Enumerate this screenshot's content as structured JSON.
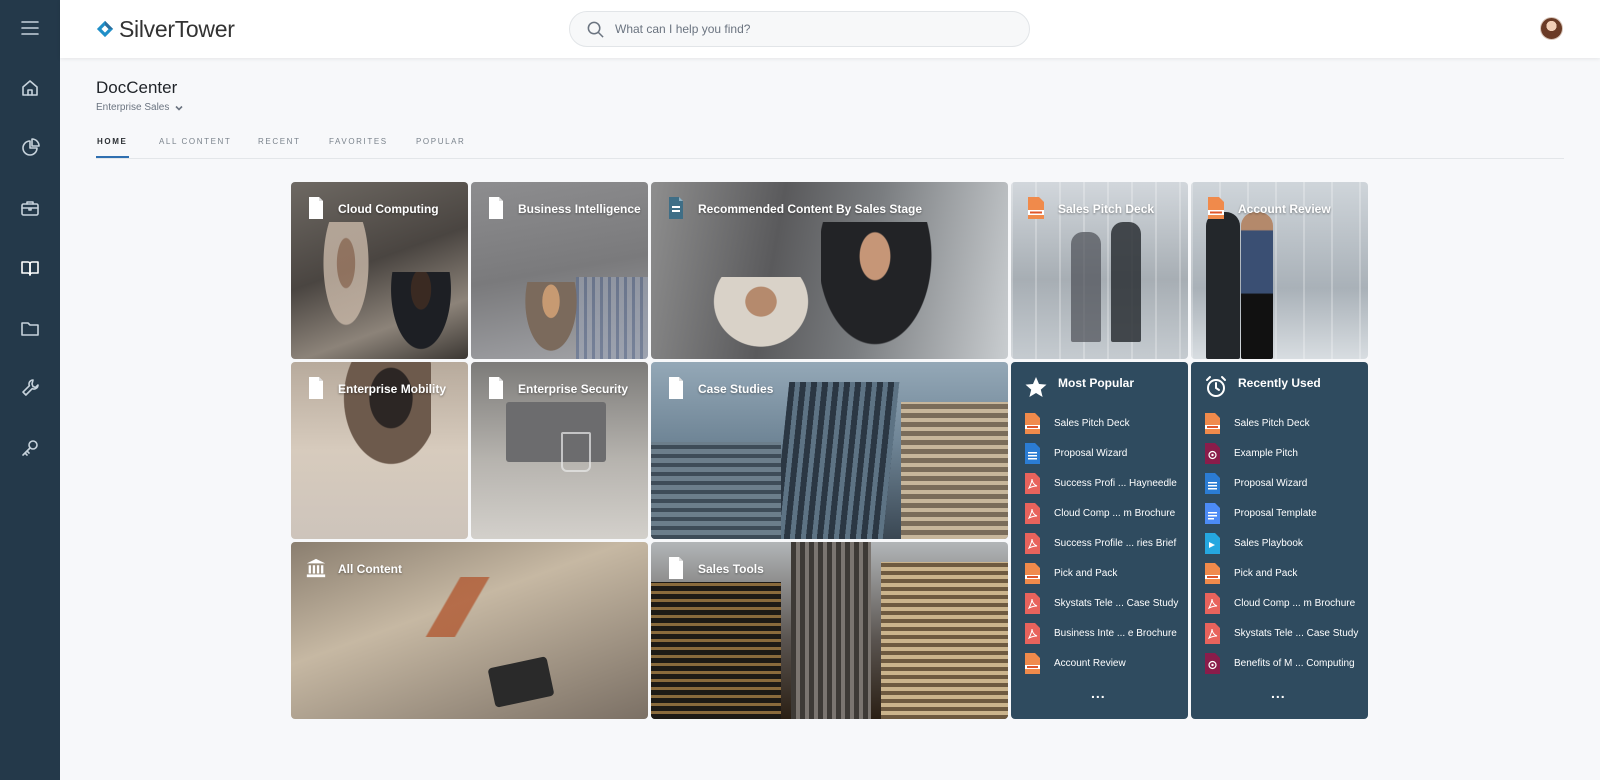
{
  "sidebar": {
    "items": [
      {
        "icon": "hamburger-menu-icon"
      },
      {
        "icon": "home-icon"
      },
      {
        "icon": "pie-chart-icon"
      },
      {
        "icon": "briefcase-icon"
      },
      {
        "icon": "open-book-icon"
      },
      {
        "icon": "folder-icon"
      },
      {
        "icon": "wrench-icon"
      },
      {
        "icon": "key-icon"
      }
    ],
    "active_index": 4,
    "background": "#24394a"
  },
  "header": {
    "logo_text": "SilverTower",
    "search_placeholder": "What can I help you find?"
  },
  "page": {
    "title": "DocCenter",
    "subtitle": "Enterprise Sales"
  },
  "tabs": [
    {
      "label": "HOME",
      "active": true
    },
    {
      "label": "ALL CONTENT",
      "active": false
    },
    {
      "label": "RECENT",
      "active": false
    },
    {
      "label": "FAVORITES",
      "active": false
    },
    {
      "label": "POPULAR",
      "active": false
    }
  ],
  "tiles": {
    "cloud_computing": "Cloud Computing",
    "business_intelligence": "Business Intelligence",
    "recommended": "Recommended Content By Sales Stage",
    "sales_pitch_deck": "Sales Pitch Deck",
    "account_review": "Account Review",
    "enterprise_mobility": "Enterprise Mobility",
    "enterprise_security": "Enterprise Security",
    "case_studies": "Case Studies",
    "all_content": "All Content",
    "sales_tools": "Sales Tools"
  },
  "most_popular": {
    "title": "Most Popular",
    "items": [
      {
        "label": "Sales Pitch Deck",
        "type": "livedoc"
      },
      {
        "label": "Proposal Wizard",
        "type": "word"
      },
      {
        "label": "Success Profi ... Hayneedle",
        "type": "pdf"
      },
      {
        "label": "Cloud Comp ... m Brochure",
        "type": "pdf"
      },
      {
        "label": "Success Profile ... ries Brief",
        "type": "pdf"
      },
      {
        "label": "Pick and Pack",
        "type": "livedoc"
      },
      {
        "label": "Skystats Tele ... Case Study",
        "type": "pdf"
      },
      {
        "label": "Business Inte ... e Brochure",
        "type": "pdf"
      },
      {
        "label": "Account Review",
        "type": "livedoc"
      }
    ],
    "more": "..."
  },
  "recently_used": {
    "title": "Recently Used",
    "items": [
      {
        "label": "Sales Pitch Deck",
        "type": "livedoc"
      },
      {
        "label": "Example Pitch",
        "type": "pitch"
      },
      {
        "label": "Proposal Wizard",
        "type": "word"
      },
      {
        "label": "Proposal Template",
        "type": "gdoc"
      },
      {
        "label": "Sales Playbook",
        "type": "playbook"
      },
      {
        "label": "Pick and Pack",
        "type": "livedoc"
      },
      {
        "label": "Cloud Comp ... m Brochure",
        "type": "pdf"
      },
      {
        "label": "Skystats Tele ... Case Study",
        "type": "pdf"
      },
      {
        "label": "Benefits of M ... Computing",
        "type": "pitch"
      }
    ],
    "more": "..."
  },
  "colors": {
    "accent": "#2f6fb0",
    "list_tile_bg": "#2f4b5f",
    "logo_diamond": "#1f8fc8"
  }
}
